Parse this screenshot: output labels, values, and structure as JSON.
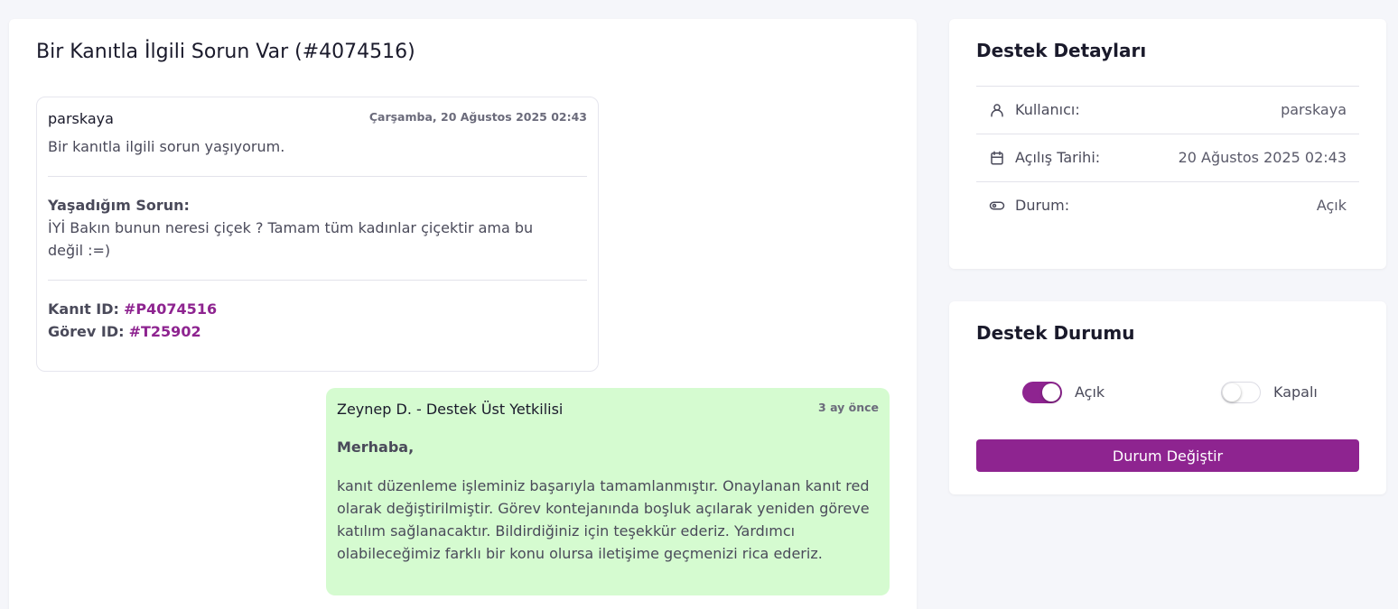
{
  "ticket": {
    "title": "Bir Kanıtla İlgili Sorun Var (#4074516)"
  },
  "messages": {
    "user": {
      "author": "parskaya",
      "time": "Çarşamba, 20 Ağustos 2025 02:43",
      "text": "Bir kanıtla ilgili sorun yaşıyorum.",
      "problem_label": "Yaşadığım Sorun:",
      "problem_text": "İYİ Bakın bunun neresi çiçek ? Tamam tüm kadınlar çiçektir ama bu değil :=)",
      "evidence_label": "Kanıt ID:",
      "evidence_id": "#P4074516",
      "task_label": "Görev ID:",
      "task_id": "#T25902"
    },
    "admin": {
      "author": "Zeynep D. - Destek Üst Yetkilisi",
      "time": "3 ay önce",
      "greeting": "Merhaba,",
      "text": "kanıt düzenleme işleminiz başarıyla tamamlanmıştır. Onaylanan kanıt red olarak değiştirilmiştir. Görev kontejanında boşluk açılarak yeniden göreve katılım sağlanacaktır. Bildirdiğiniz için teşekkür ederiz. Yardımcı olabileceğimiz farklı bir konu olursa iletişime geçmenizi rica ederiz."
    }
  },
  "details": {
    "title": "Destek Detayları",
    "rows": [
      {
        "label": "Kullanıcı:",
        "value": "parskaya",
        "icon": "user-icon"
      },
      {
        "label": "Açılış Tarihi:",
        "value": "20 Ağustos 2025 02:43",
        "icon": "calendar-icon"
      },
      {
        "label": "Durum:",
        "value": "Açık",
        "icon": "toggle-icon"
      }
    ]
  },
  "status_panel": {
    "title": "Destek Durumu",
    "open_label": "Açık",
    "open_checked": true,
    "closed_label": "Kapalı",
    "closed_checked": false,
    "button_label": "Durum Değiştir"
  },
  "colors": {
    "accent": "#8e2490",
    "admin_bubble": "#d5fbd0"
  }
}
